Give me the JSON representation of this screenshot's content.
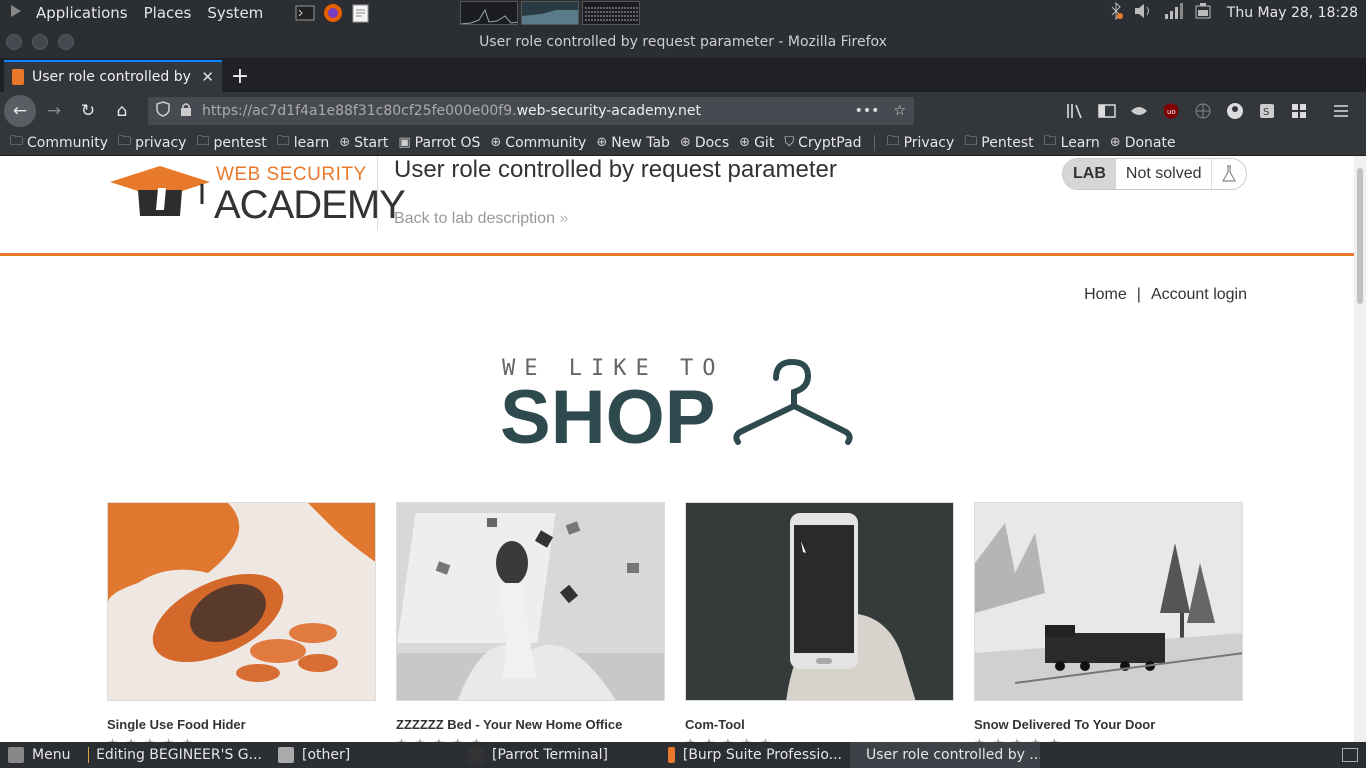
{
  "system_panel": {
    "menus": [
      "Applications",
      "Places",
      "System"
    ],
    "clock": "Thu May 28, 18:28"
  },
  "window": {
    "title": "User role controlled by request parameter - Mozilla Firefox"
  },
  "tabs": [
    {
      "title": "User role controlled by re",
      "active": true
    }
  ],
  "navbar": {
    "url_prefix": "https://ac7d1f4a1e88f31c80cf25fe000e00f9.",
    "url_host": "web-security-academy.net",
    "page_actions": "•••"
  },
  "bookmarks": [
    {
      "label": "Community",
      "icon": "folder-icon"
    },
    {
      "label": "privacy",
      "icon": "folder-icon"
    },
    {
      "label": "pentest",
      "icon": "folder-icon"
    },
    {
      "label": "learn",
      "icon": "folder-icon"
    },
    {
      "label": "Start",
      "icon": "globe-icon"
    },
    {
      "label": "Parrot OS",
      "icon": "parrot-icon"
    },
    {
      "label": "Community",
      "icon": "globe-icon"
    },
    {
      "label": "New Tab",
      "icon": "globe-icon"
    },
    {
      "label": "Docs",
      "icon": "globe-icon"
    },
    {
      "label": "Git",
      "icon": "globe-icon"
    },
    {
      "label": "CryptPad",
      "icon": "shield-icon"
    },
    {
      "label": "Privacy",
      "icon": "folder-icon"
    },
    {
      "label": "Pentest",
      "icon": "folder-icon"
    },
    {
      "label": "Learn",
      "icon": "folder-icon"
    },
    {
      "label": "Donate",
      "icon": "globe-icon"
    }
  ],
  "lab_header": {
    "logo_top": "WEB SECURITY",
    "logo_bottom": "ACADEMY",
    "title": "User role controlled by request parameter",
    "back_link": "Back to lab description",
    "lab_badge": "LAB",
    "status": "Not solved"
  },
  "site_nav": {
    "home": "Home",
    "separator": "|",
    "account": "Account login"
  },
  "shop_logo": {
    "sub": "WE LIKE TO",
    "main": "SHOP"
  },
  "products": [
    {
      "name": "Single Use Food Hider"
    },
    {
      "name": "ZZZZZZ Bed - Your New Home Office"
    },
    {
      "name": "Com-Tool"
    },
    {
      "name": "Snow Delivered To Your Door"
    }
  ],
  "taskbar": {
    "items": [
      {
        "label": "Menu",
        "icon": "menu-icon"
      },
      {
        "label": "Editing BEGINEER'S G...",
        "icon": "chrome-icon"
      },
      {
        "label": "[other]",
        "icon": "folder-icon"
      },
      {
        "label": "[Parrot Terminal]",
        "icon": "terminal-icon"
      },
      {
        "label": "[Burp Suite Professio...",
        "icon": "burp-icon"
      },
      {
        "label": "User role controlled by ...",
        "icon": "firefox-icon"
      }
    ]
  },
  "colors": {
    "accent_orange": "#e8792c",
    "shop_teal": "#2f4a4f",
    "chrome_dark": "#33363b"
  }
}
